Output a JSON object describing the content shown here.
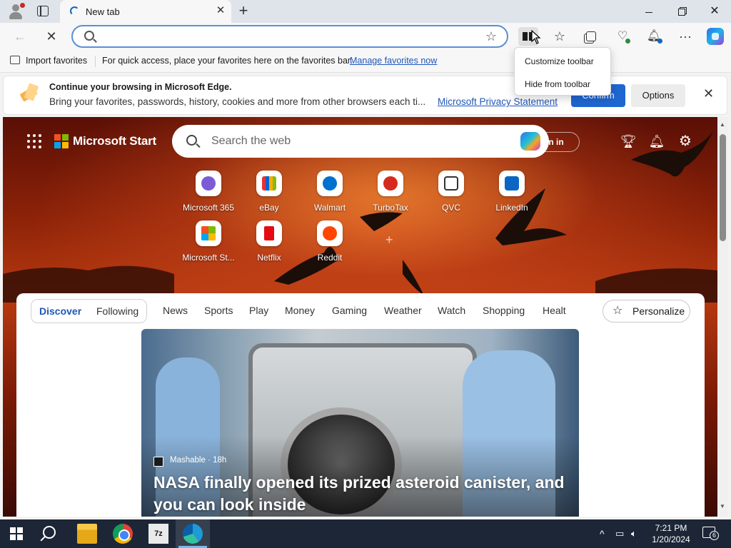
{
  "browser": {
    "tab_title": "New tab",
    "new_tab_symbol": "+",
    "close_symbol": "✕",
    "address_placeholder": "",
    "icons": [
      "profile-icon",
      "tab-actions-icon",
      "back-icon",
      "stop-icon",
      "search-icon",
      "favorite-star-icon",
      "split-screen-icon",
      "favorites-icon",
      "collections-icon",
      "browser-essentials-icon",
      "notifications-icon",
      "more-icon",
      "copilot-icon"
    ]
  },
  "favorites_bar": {
    "import_label": "Import favorites",
    "hint": "For quick access, place your favorites here on the favorites bar.",
    "manage_link": "Manage favorites now"
  },
  "infobar": {
    "title": "Continue your browsing in Microsoft Edge.",
    "text": "Bring your favorites, passwords, history, cookies and more from other browsers each ti...",
    "link": "Microsoft Privacy Statement",
    "confirm_label": "Confirm",
    "options_label": "Options"
  },
  "context_menu": {
    "items": [
      "Customize toolbar",
      "Hide from toolbar"
    ]
  },
  "start_page": {
    "brand": "Microsoft Start",
    "search_placeholder": "Search the web",
    "signin_label": "Sign in",
    "signin_visible": "gn in",
    "tiles": [
      {
        "label": "Microsoft 365",
        "color": "#7b5cd6"
      },
      {
        "label": "eBay",
        "color": "#e53238"
      },
      {
        "label": "Walmart",
        "color": "#0071ce"
      },
      {
        "label": "TurboTax",
        "color": "#d52b1e"
      },
      {
        "label": "QVC",
        "color": "#333333"
      },
      {
        "label": "LinkedIn",
        "color": "#0a66c2"
      },
      {
        "label": "Microsoft St...",
        "color": "#f25022"
      },
      {
        "label": "Netflix",
        "color": "#e50914"
      },
      {
        "label": "Reddit",
        "color": "#ff4500"
      }
    ],
    "feed": {
      "pill_tabs": [
        "Discover",
        "Following"
      ],
      "tabs": [
        "News",
        "Sports",
        "Play",
        "Money",
        "Gaming",
        "Weather",
        "Watch",
        "Shopping",
        "Healt"
      ],
      "personalize_label": "Personalize",
      "hero": {
        "source": "Mashable · 18h",
        "headline": "NASA finally opened its prized asteroid canister, and you can look inside"
      }
    }
  },
  "taskbar": {
    "time": "7:21 PM",
    "date": "1/20/2024",
    "notification_count": "6",
    "zip_label": "7z"
  },
  "colors": {
    "accent": "#1f66d1",
    "link": "#1f56b6",
    "taskbar": "#1c2636"
  }
}
